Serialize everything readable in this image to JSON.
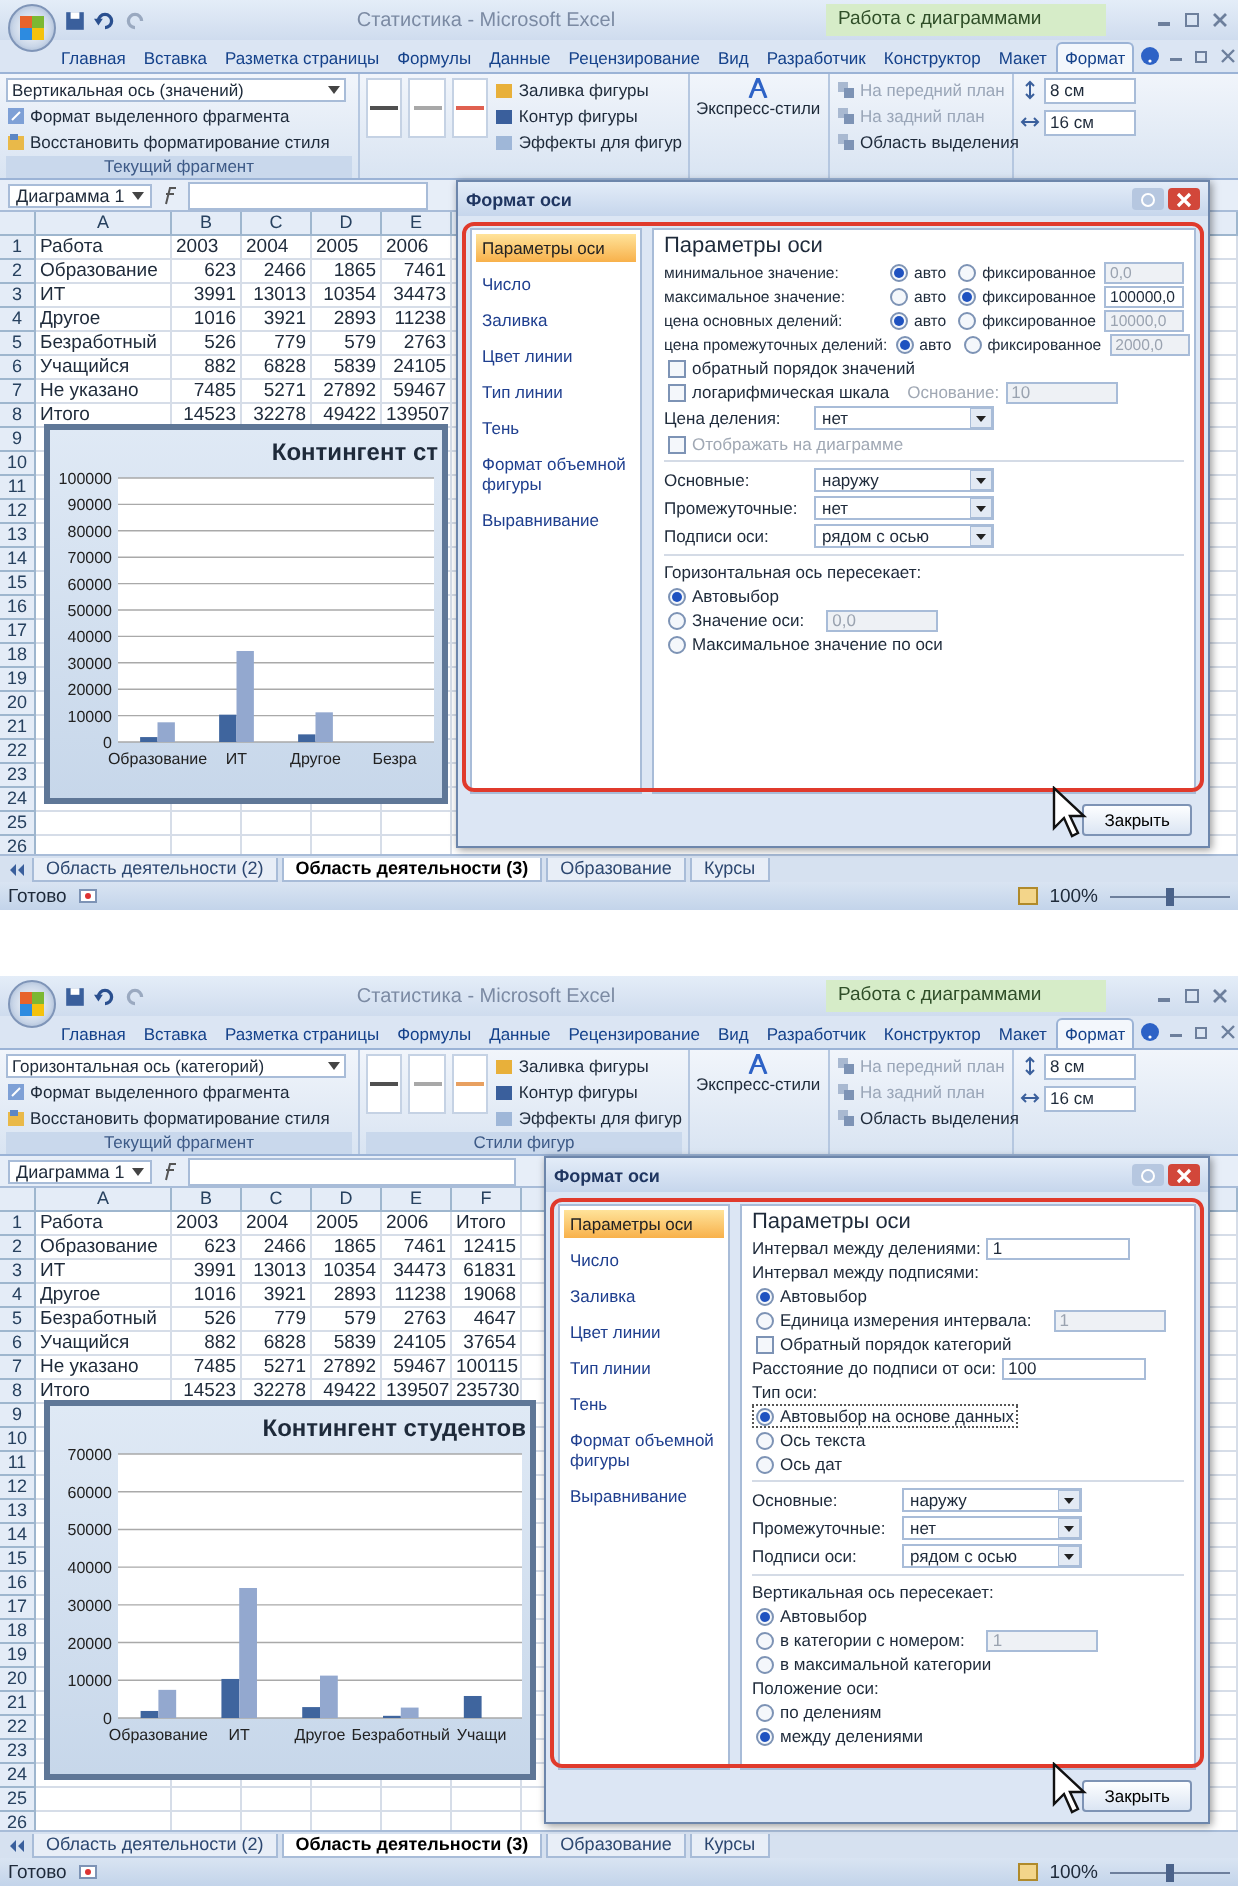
{
  "screens": [
    {
      "window": {
        "title": "Статистика - Microsoft Excel",
        "context_group": "Работа с диаграммами"
      },
      "tabs": [
        {
          "label": "Главная",
          "selected": false
        },
        {
          "label": "Вставка",
          "selected": false
        },
        {
          "label": "Разметка страницы",
          "selected": false
        },
        {
          "label": "Формулы",
          "selected": false
        },
        {
          "label": "Данные",
          "selected": false
        },
        {
          "label": "Рецензирование",
          "selected": false
        },
        {
          "label": "Вид",
          "selected": false
        },
        {
          "label": "Разработчик",
          "selected": false
        },
        {
          "label": "Конструктор",
          "selected": false
        },
        {
          "label": "Макет",
          "selected": false
        },
        {
          "label": "Формат",
          "selected": true
        }
      ],
      "ribbon": {
        "selection_combo": "Вертикальная ось (значений)",
        "format_button": "Формат выделенного фрагмента",
        "reset_button": "Восстановить форматирование стиля",
        "group_label": "Текущий фрагмент",
        "style_swatches": [
          {
            "color": "#505050"
          },
          {
            "color": "#a8a8a8"
          },
          {
            "color": "#e06050"
          }
        ],
        "shape_buttons": [
          "Заливка фигуры",
          "Контур фигуры",
          "Эффекты для фигур"
        ],
        "quick_styles": "Экспресс-стили",
        "arrange": [
          {
            "label": "На передний план",
            "disabled": true
          },
          {
            "label": "На задний план",
            "disabled": true
          },
          {
            "label": "Область выделения",
            "disabled": false
          }
        ],
        "sizes": [
          "8 см",
          "16 см"
        ]
      },
      "name_box": "Диаграмма 1",
      "columns": [
        "A",
        "B",
        "C",
        "D",
        "E"
      ],
      "rows": [
        {
          "n": "1",
          "cells": [
            "Работа",
            "2003",
            "2004",
            "2005",
            "2006"
          ]
        },
        {
          "n": "2",
          "cells": [
            "Образование",
            "623",
            "2466",
            "1865",
            "7461"
          ]
        },
        {
          "n": "3",
          "cells": [
            "ИТ",
            "3991",
            "13013",
            "10354",
            "34473"
          ]
        },
        {
          "n": "4",
          "cells": [
            "Другое",
            "1016",
            "3921",
            "2893",
            "11238"
          ]
        },
        {
          "n": "5",
          "cells": [
            "Безработный",
            "526",
            "779",
            "579",
            "2763"
          ]
        },
        {
          "n": "6",
          "cells": [
            "Учащийся",
            "882",
            "6828",
            "5839",
            "24105"
          ]
        },
        {
          "n": "7",
          "cells": [
            "Не указано",
            "7485",
            "5271",
            "27892",
            "59467"
          ]
        },
        {
          "n": "8",
          "cells": [
            "Итого",
            "14523",
            "32278",
            "49422",
            "139507"
          ]
        }
      ],
      "empty_rows": [
        "9",
        "10",
        "11",
        "12",
        "13",
        "14",
        "15",
        "16",
        "17",
        "18",
        "19",
        "20",
        "21",
        "22",
        "23",
        "24",
        "25",
        "26"
      ],
      "chart": {
        "chart_data": {
          "type": "bar",
          "title": "Контингент ст",
          "categories": [
            "Образование",
            "ИТ",
            "Другое",
            "Безра"
          ],
          "series": [
            {
              "color": "#3f659e",
              "values": [
                1865,
                10354,
                2893,
                null
              ]
            },
            {
              "color": "#93a8cf",
              "values": [
                7461,
                34473,
                11238,
                null
              ]
            }
          ],
          "ylim": [
            0,
            100000
          ],
          "yticks": [
            0,
            10000,
            20000,
            30000,
            40000,
            50000,
            60000,
            70000,
            80000,
            90000,
            100000
          ],
          "grid": true
        }
      },
      "dialog": {
        "title": "Формат оси",
        "nav": [
          {
            "label": "Параметры оси",
            "selected": true
          },
          {
            "label": "Число",
            "selected": false
          },
          {
            "label": "Заливка",
            "selected": false
          },
          {
            "label": "Цвет линии",
            "selected": false
          },
          {
            "label": "Тип линии",
            "selected": false
          },
          {
            "label": "Тень",
            "selected": false
          },
          {
            "label": "Формат объемной фигуры",
            "selected": false
          },
          {
            "label": "Выравнивание",
            "selected": false
          }
        ],
        "items": [
          {
            "kind": "heading",
            "text": "Параметры оси"
          },
          {
            "kind": "choice",
            "label": "минимальное значение:",
            "options": [
              {
                "label": "авто",
                "selected": true
              },
              {
                "label": "фиксированное",
                "selected": false
              }
            ],
            "value": "0,0",
            "disabled": true
          },
          {
            "kind": "choice",
            "label": "максимальное значение:",
            "options": [
              {
                "label": "авто",
                "selected": false
              },
              {
                "label": "фиксированное",
                "selected": true
              }
            ],
            "value": "100000,0",
            "disabled": false
          },
          {
            "kind": "choice",
            "label": "цена основных делений:",
            "options": [
              {
                "label": "авто",
                "selected": true
              },
              {
                "label": "фиксированное",
                "selected": false
              }
            ],
            "value": "10000,0",
            "disabled": true
          },
          {
            "kind": "choice",
            "label": "цена промежуточных делений:",
            "options": [
              {
                "label": "авто",
                "selected": true
              },
              {
                "label": "фиксированное",
                "selected": false
              }
            ],
            "value": "2000,0",
            "disabled": true
          },
          {
            "kind": "checkbox",
            "label": "обратный порядок значений",
            "checked": false,
            "disabled": false
          },
          {
            "kind": "checkbox",
            "label": "логарифмическая шкала",
            "checked": false,
            "disabled": false,
            "base_label": "Основание:",
            "base_value": "10",
            "base_disabled": true
          },
          {
            "kind": "select",
            "label": "Цена деления:",
            "value": "нет"
          },
          {
            "kind": "checkbox",
            "label": "Отображать на диаграмме",
            "checked": false,
            "disabled": true
          },
          {
            "kind": "separator"
          },
          {
            "kind": "select",
            "label": "Основные:",
            "value": "наружу"
          },
          {
            "kind": "select",
            "label": "Промежуточные:",
            "value": "нет"
          },
          {
            "kind": "select",
            "label": "Подписи оси:",
            "value": "рядом с осью"
          },
          {
            "kind": "separator"
          },
          {
            "kind": "caption",
            "text": "Горизонтальная ось пересекает:"
          },
          {
            "kind": "radio",
            "label": "Автовыбор",
            "selected": true
          },
          {
            "kind": "radio",
            "label": "Значение оси:",
            "selected": false,
            "value": "0,0",
            "disabled": true
          },
          {
            "kind": "radio",
            "label": "Максимальное значение по оси",
            "selected": false
          }
        ],
        "close_button": "Закрыть"
      },
      "sheet_tabs": [
        {
          "label": "Область деятельности (2)",
          "selected": false
        },
        {
          "label": "Область деятельности (3)",
          "selected": true
        },
        {
          "label": "Образование",
          "selected": false
        },
        {
          "label": "Курсы",
          "selected": false
        }
      ],
      "status": {
        "text": "Готово",
        "zoom": "100%",
        "zoom_slider": {
          "level": 0.5
        }
      }
    },
    {
      "window": {
        "title": "Статистика - Microsoft Excel",
        "context_group": "Работа с диаграммами"
      },
      "tabs": [
        {
          "label": "Главная",
          "selected": false
        },
        {
          "label": "Вставка",
          "selected": false
        },
        {
          "label": "Разметка страницы",
          "selected": false
        },
        {
          "label": "Формулы",
          "selected": false
        },
        {
          "label": "Данные",
          "selected": false
        },
        {
          "label": "Рецензирование",
          "selected": false
        },
        {
          "label": "Вид",
          "selected": false
        },
        {
          "label": "Разработчик",
          "selected": false
        },
        {
          "label": "Конструктор",
          "selected": false
        },
        {
          "label": "Макет",
          "selected": false
        },
        {
          "label": "Формат",
          "selected": true
        }
      ],
      "ribbon": {
        "selection_combo": "Горизонтальная ось (категорий)",
        "format_button": "Формат выделенного фрагмента",
        "reset_button": "Восстановить форматирование стиля",
        "group_label": "Текущий фрагмент",
        "style_swatches": [
          {
            "color": "#505050"
          },
          {
            "color": "#a8a8a8"
          },
          {
            "color": "#e8a060"
          }
        ],
        "styles_label": "Стили фигур",
        "shape_buttons": [
          "Заливка фигуры",
          "Контур фигуры",
          "Эффекты для фигур"
        ],
        "quick_styles": "Экспресс-стили",
        "arrange": [
          {
            "label": "На передний план",
            "disabled": true
          },
          {
            "label": "На задний план",
            "disabled": true
          },
          {
            "label": "Область выделения",
            "disabled": false
          }
        ],
        "sizes": [
          "8 см",
          "16 см"
        ]
      },
      "name_box": "Диаграмма 1",
      "columns": [
        "A",
        "B",
        "C",
        "D",
        "E",
        "F"
      ],
      "rows": [
        {
          "n": "1",
          "cells": [
            "Работа",
            "2003",
            "2004",
            "2005",
            "2006",
            "Итого"
          ]
        },
        {
          "n": "2",
          "cells": [
            "Образование",
            "623",
            "2466",
            "1865",
            "7461",
            "12415"
          ]
        },
        {
          "n": "3",
          "cells": [
            "ИТ",
            "3991",
            "13013",
            "10354",
            "34473",
            "61831"
          ]
        },
        {
          "n": "4",
          "cells": [
            "Другое",
            "1016",
            "3921",
            "2893",
            "11238",
            "19068"
          ]
        },
        {
          "n": "5",
          "cells": [
            "Безработный",
            "526",
            "779",
            "579",
            "2763",
            "4647"
          ]
        },
        {
          "n": "6",
          "cells": [
            "Учащийся",
            "882",
            "6828",
            "5839",
            "24105",
            "37654"
          ]
        },
        {
          "n": "7",
          "cells": [
            "Не указано",
            "7485",
            "5271",
            "27892",
            "59467",
            "100115"
          ]
        },
        {
          "n": "8",
          "cells": [
            "Итого",
            "14523",
            "32278",
            "49422",
            "139507",
            "235730"
          ]
        }
      ],
      "empty_rows": [
        "9",
        "10",
        "11",
        "12",
        "13",
        "14",
        "15",
        "16",
        "17",
        "18",
        "19",
        "20",
        "21",
        "22",
        "23",
        "24",
        "25",
        "26"
      ],
      "chart": {
        "chart_data": {
          "type": "bar",
          "title": "Контингент студентов",
          "categories": [
            "Образование",
            "ИТ",
            "Другое",
            "Безработный",
            "Учащи"
          ],
          "series": [
            {
              "color": "#3f659e",
              "values": [
                1865,
                10354,
                2893,
                579,
                5839
              ]
            },
            {
              "color": "#93a8cf",
              "values": [
                7461,
                34473,
                11238,
                2763,
                null
              ]
            }
          ],
          "ylim": [
            0,
            70000
          ],
          "yticks": [
            0,
            10000,
            20000,
            30000,
            40000,
            50000,
            60000,
            70000
          ],
          "grid": true
        }
      },
      "dialog": {
        "title": "Формат оси",
        "nav": [
          {
            "label": "Параметры оси",
            "selected": true
          },
          {
            "label": "Число",
            "selected": false
          },
          {
            "label": "Заливка",
            "selected": false
          },
          {
            "label": "Цвет линии",
            "selected": false
          },
          {
            "label": "Тип линии",
            "selected": false
          },
          {
            "label": "Тень",
            "selected": false
          },
          {
            "label": "Формат объемной фигуры",
            "selected": false
          },
          {
            "label": "Выравнивание",
            "selected": false
          }
        ],
        "items": [
          {
            "kind": "heading",
            "text": "Параметры оси"
          },
          {
            "kind": "field",
            "label": "Интервал между делениями:",
            "value": "1"
          },
          {
            "kind": "caption",
            "text": "Интервал между подписями:"
          },
          {
            "kind": "radio",
            "label": "Автовыбор",
            "selected": true
          },
          {
            "kind": "radio",
            "label": "Единица измерения интервала:",
            "selected": false,
            "value": "1",
            "disabled": true
          },
          {
            "kind": "checkbox",
            "label": "Обратный порядок категорий",
            "checked": false,
            "disabled": false
          },
          {
            "kind": "field",
            "label": "Расстояние до подписи от оси:",
            "value": "100"
          },
          {
            "kind": "caption",
            "text": "Тип оси:"
          },
          {
            "kind": "radio",
            "label": "Автовыбор на основе данных",
            "selected": true,
            "focused": true
          },
          {
            "kind": "radio",
            "label": "Ось текста",
            "selected": false
          },
          {
            "kind": "radio",
            "label": "Ось дат",
            "selected": false
          },
          {
            "kind": "separator"
          },
          {
            "kind": "select",
            "label": "Основные:",
            "value": "наружу"
          },
          {
            "kind": "select",
            "label": "Промежуточные:",
            "value": "нет"
          },
          {
            "kind": "select",
            "label": "Подписи оси:",
            "value": "рядом с осью"
          },
          {
            "kind": "separator"
          },
          {
            "kind": "caption",
            "text": "Вертикальная ось пересекает:"
          },
          {
            "kind": "radio",
            "label": "Автовыбор",
            "selected": true
          },
          {
            "kind": "radio",
            "label": "в категории с номером:",
            "selected": false,
            "value": "1",
            "disabled": true
          },
          {
            "kind": "radio",
            "label": "в максимальной категории",
            "selected": false
          },
          {
            "kind": "caption",
            "text": "Положение оси:"
          },
          {
            "kind": "radio",
            "label": "по делениям",
            "selected": false
          },
          {
            "kind": "radio",
            "label": "между делениями",
            "selected": true
          }
        ],
        "close_button": "Закрыть"
      },
      "sheet_tabs": [
        {
          "label": "Область деятельности (2)",
          "selected": false
        },
        {
          "label": "Область деятельности (3)",
          "selected": true
        },
        {
          "label": "Образование",
          "selected": false
        },
        {
          "label": "Курсы",
          "selected": false
        }
      ],
      "status": {
        "text": "Готово",
        "zoom": "100%",
        "zoom_slider": {
          "level": 0.5
        }
      }
    }
  ]
}
